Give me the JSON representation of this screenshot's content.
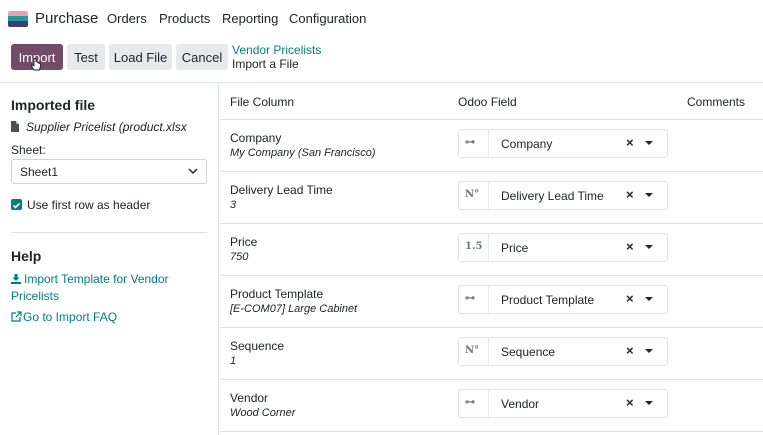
{
  "navbar": {
    "app_name": "Purchase",
    "menu": [
      "Orders",
      "Products",
      "Reporting",
      "Configuration"
    ]
  },
  "control_panel": {
    "import_label": "Import",
    "test_label": "Test",
    "load_file_label": "Load File",
    "cancel_label": "Cancel",
    "breadcrumb_link": "Vendor Pricelists",
    "breadcrumb_current": "Import a File"
  },
  "left_panel": {
    "imported_title": "Imported file",
    "file_name": "Supplier Pricelist (product.xlsx",
    "sheet_label": "Sheet:",
    "sheet_value": "Sheet1",
    "header_checkbox_label": "Use first row as header",
    "header_checked": true,
    "help_title": "Help",
    "help_template_link": "Import Template for Vendor Pricelists",
    "help_faq_link": "Go to Import FAQ"
  },
  "table": {
    "headers": [
      "File Column",
      "Odoo Field",
      "Comments"
    ],
    "rows": [
      {
        "column": "Company",
        "sample": "My Company (San Francisco)",
        "field": "Company",
        "type_icon": "relation-icon",
        "type_label": "⊶"
      },
      {
        "column": "Delivery Lead Time",
        "sample": "3",
        "field": "Delivery Lead Time",
        "type_icon": "integer-icon",
        "type_label": "N°"
      },
      {
        "column": "Price",
        "sample": "750",
        "field": "Price",
        "type_icon": "float-icon",
        "type_label": "1.5"
      },
      {
        "column": "Product Template",
        "sample": "[E-COM07] Large Cabinet",
        "field": "Product Template",
        "type_icon": "relation-icon",
        "type_label": "⊶"
      },
      {
        "column": "Sequence",
        "sample": "1",
        "field": "Sequence",
        "type_icon": "integer-icon",
        "type_label": "N°"
      },
      {
        "column": "Vendor",
        "sample": "Wood Corner",
        "field": "Vendor",
        "type_icon": "relation-icon",
        "type_label": "⊶"
      }
    ]
  },
  "colors": {
    "primary": "#714b67",
    "link": "#017e84",
    "secondary_button": "#e7e9ed"
  }
}
